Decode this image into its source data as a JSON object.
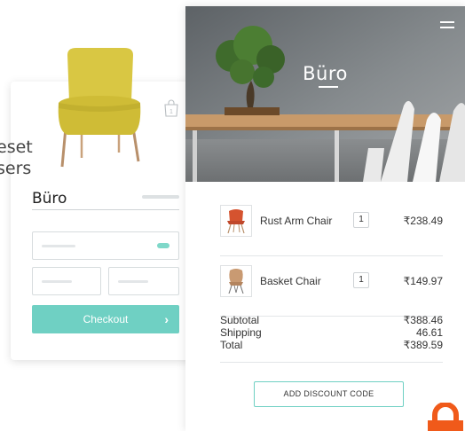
{
  "overlay_text": {
    "line1": "eset",
    "line2": "sers"
  },
  "card": {
    "brand": "Büro",
    "checkout_label": "Checkout",
    "checkout_arrow": "›"
  },
  "panel": {
    "brand": "Büro",
    "items": [
      {
        "name": "Rust Arm Chair",
        "qty": "1",
        "price": "₹238.49"
      },
      {
        "name": "Basket Chair",
        "qty": "1",
        "price": "₹149.97"
      }
    ],
    "totals": {
      "subtotal_label": "Subtotal",
      "subtotal_value": "₹388.46",
      "shipping_label": "Shipping",
      "shipping_value": "46.61",
      "total_label": "Total",
      "total_value": "₹389.59"
    },
    "discount_label": "ADD DISCOUNT CODE"
  },
  "colors": {
    "accent": "#6fd0c3",
    "chair_yellow": "#d9c743",
    "chair_rust": "#d5532f",
    "lock_orange": "#f05a1a"
  },
  "icons": [
    "menu-icon",
    "shopping-bag-icon",
    "lock-icon",
    "chevron-right-icon"
  ]
}
